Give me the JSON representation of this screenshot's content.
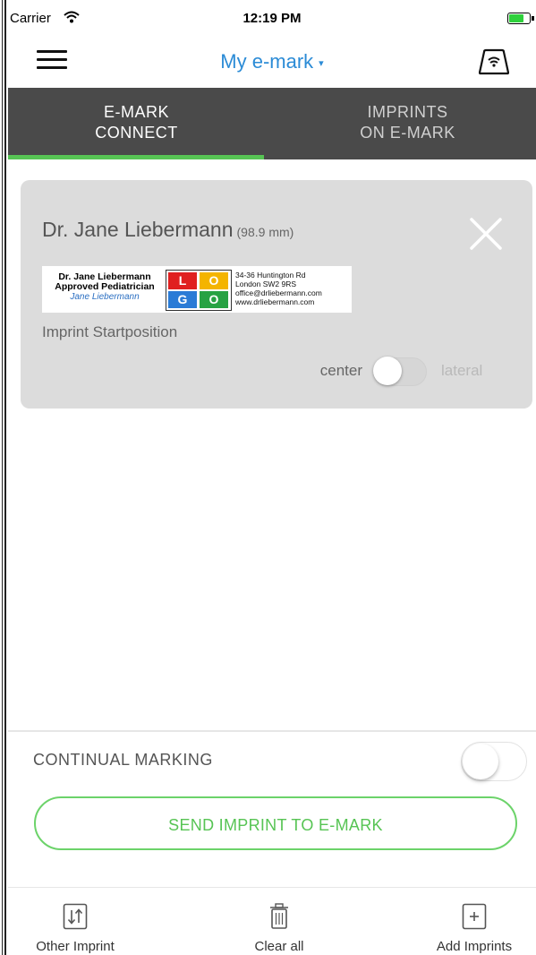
{
  "status_bar": {
    "carrier": "Carrier",
    "time": "12:19 PM",
    "battery_level": 0.8
  },
  "nav": {
    "title": "My e-mark",
    "caret": "▾"
  },
  "tabs": [
    {
      "line1": "E-MARK",
      "line2": "CONNECT",
      "active": true
    },
    {
      "line1": "IMPRINTS",
      "line2": "ON E-MARK",
      "active": false
    }
  ],
  "card": {
    "title": "Dr. Jane Liebermann",
    "size": "(98.9 mm)",
    "preview": {
      "name": "Dr. Jane Liebermann",
      "role": "Approved Pediatrician",
      "signature": "Jane Liebermann",
      "logo": [
        "L",
        "O",
        "G",
        "O"
      ],
      "address_lines": [
        "34-36 Huntington Rd",
        "London SW2 9RS",
        "office@drliebermann.com",
        "www.drliebermann.com"
      ]
    },
    "subtitle": "Imprint Startposition",
    "toggle_left": "center",
    "toggle_right": "lateral"
  },
  "continual_marking": {
    "label": "CONTINUAL MARKING",
    "on": false
  },
  "send_button": "SEND IMPRINT TO E-MARK",
  "bottom_bar": [
    {
      "label": "Other Imprint",
      "icon": "swap-vertical-icon"
    },
    {
      "label": "Clear all",
      "icon": "trash-icon"
    },
    {
      "label": "Add Imprints",
      "icon": "add-square-icon"
    }
  ],
  "colors": {
    "accent_blue": "#2b8bd6",
    "accent_green": "#57c454",
    "tab_bg": "#4a4a4a",
    "card_bg": "#dcdcdc"
  }
}
